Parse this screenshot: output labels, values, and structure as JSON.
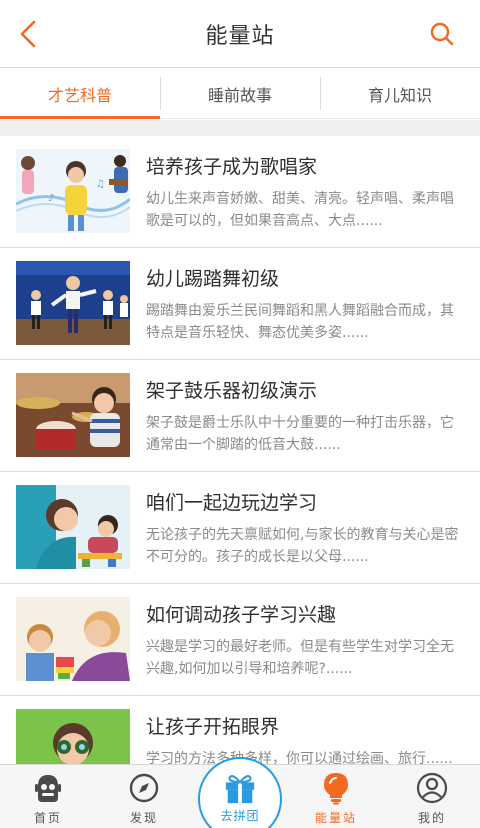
{
  "header": {
    "title": "能量站",
    "back_icon": "chevron-left-icon",
    "search_icon": "search-icon",
    "accent": "#f26a22"
  },
  "tabs": [
    {
      "label": "才艺科普",
      "active": true
    },
    {
      "label": "睡前故事",
      "active": false
    },
    {
      "label": "育儿知识",
      "active": false
    }
  ],
  "articles": [
    {
      "title": "培养孩子成为歌唱家",
      "desc": "幼儿生来声音娇嫩、甜美、清亮。轻声唱、柔声唱歌是可以的，但如果音高点、大点......",
      "thumb": "children-singing-image"
    },
    {
      "title": "幼儿踢踏舞初级",
      "desc": "踢踏舞由爱乐兰民间舞蹈和黑人舞蹈融合而成，其特点是音乐轻快、舞态优美多姿......",
      "thumb": "children-tap-dance-image"
    },
    {
      "title": "架子鼓乐器初级演示",
      "desc": "架子鼓是爵士乐队中十分重要的一种打击乐器，它通常由一个脚踏的低音大鼓......",
      "thumb": "child-drum-kit-image"
    },
    {
      "title": "咱们一起边玩边学习",
      "desc": "无论孩子的先天禀赋如何,与家长的教育与关心是密不可分的。孩子的成长是以父母......",
      "thumb": "mother-child-play-image"
    },
    {
      "title": "如何调动孩子学习兴趣",
      "desc": " 兴趣是学习的最好老师。但是有些学生对学习全无兴趣,如何加以引导和培养呢?......",
      "thumb": "parent-child-learning-image"
    },
    {
      "title": "让孩子开拓眼界",
      "desc": "学习的方法多种多样，你可以通过绘画、旅行......",
      "thumb": "child-binoculars-image"
    }
  ],
  "bottom_nav": [
    {
      "label": "首页",
      "icon": "robot-home-icon",
      "active": false
    },
    {
      "label": "发现",
      "icon": "compass-icon",
      "active": false
    },
    {
      "label": "去拼团",
      "icon": "gift-box-icon",
      "active": false,
      "center": true
    },
    {
      "label": "能量站",
      "icon": "lightbulb-icon",
      "active": true
    },
    {
      "label": "我的",
      "icon": "user-icon",
      "active": false
    }
  ]
}
